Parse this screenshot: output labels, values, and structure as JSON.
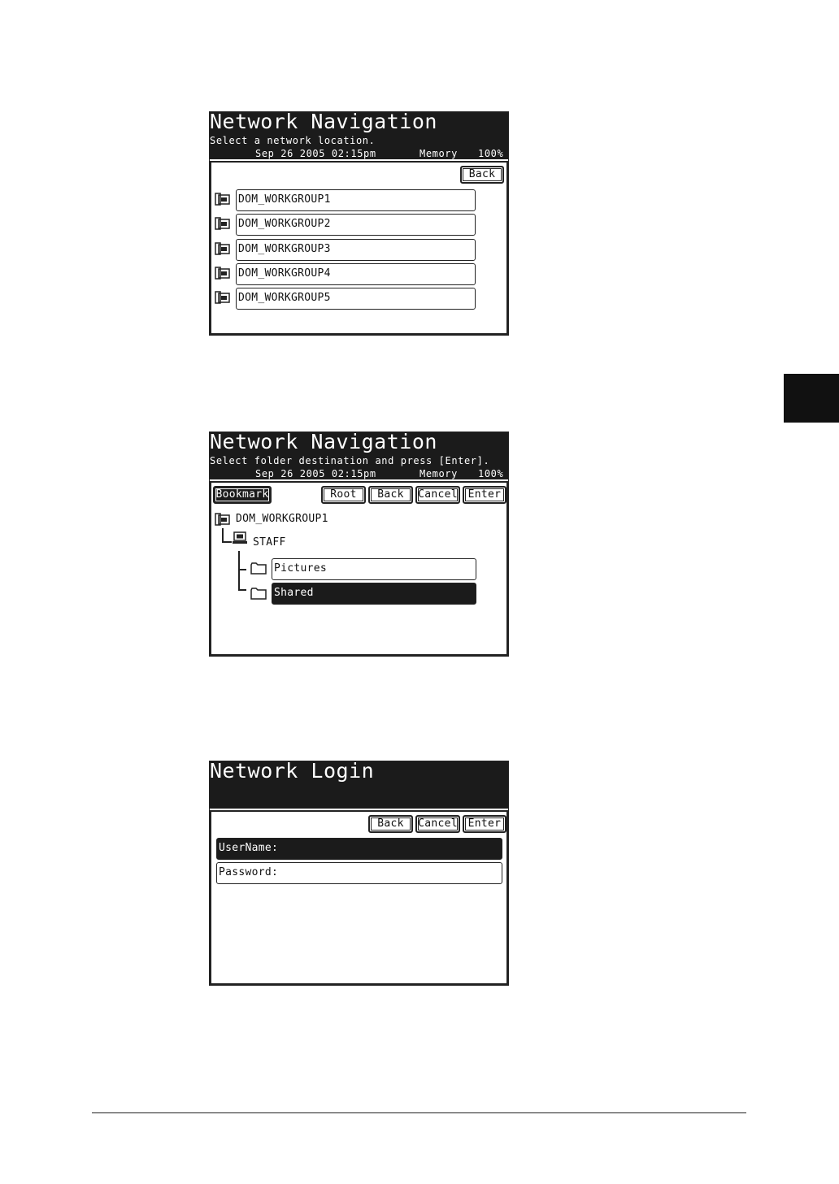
{
  "screen1": {
    "title": "Network Navigation",
    "subtitle": "Select a network location.",
    "datetime": "Sep 26 2005 02:15pm",
    "memory_label": "Memory",
    "memory_value": "100%",
    "back_label": "Back",
    "items": [
      "DOM_WORKGROUP1",
      "DOM_WORKGROUP2",
      "DOM_WORKGROUP3",
      "DOM_WORKGROUP4",
      "DOM_WORKGROUP5"
    ]
  },
  "screen2": {
    "title": "Network Navigation",
    "subtitle": "Select folder destination and press [Enter].",
    "datetime": "Sep 26 2005 02:15pm",
    "memory_label": "Memory",
    "memory_value": "100%",
    "bookmark_label": "Bookmark",
    "root_label": "Root",
    "back_label": "Back",
    "cancel_label": "Cancel",
    "enter_label": "Enter",
    "workgroup": "DOM_WORKGROUP1",
    "computer": "STAFF",
    "folders": [
      "Pictures",
      "Shared"
    ]
  },
  "screen3": {
    "title": "Network Login",
    "back_label": "Back",
    "cancel_label": "Cancel",
    "enter_label": "Enter",
    "username_label": "UserName:",
    "password_label": "Password:"
  }
}
